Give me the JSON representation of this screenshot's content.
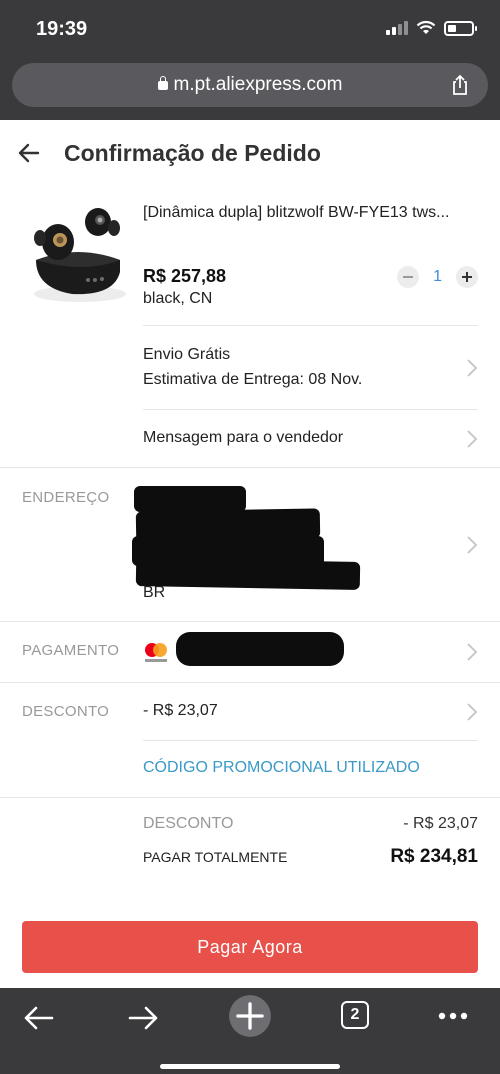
{
  "status_bar": {
    "time": "19:39"
  },
  "browser": {
    "url": "m.pt.aliexpress.com",
    "tab_count": "2"
  },
  "header": {
    "title": "Confirmação de Pedido"
  },
  "product": {
    "title": "[Dinâmica dupla] blitzwolf BW-FYE13 tws...",
    "price": "R$ 257,88",
    "variant": "black,  CN",
    "quantity": "1"
  },
  "shipping": {
    "line1": "Envio Grátis",
    "line2": "Estimativa de Entrega: 08 Nov."
  },
  "message_seller": "Mensagem para o vendedor",
  "address": {
    "label": "ENDEREÇO",
    "country": "BR"
  },
  "payment": {
    "label": "PAGAMENTO"
  },
  "discount": {
    "label": "DESCONTO",
    "value": "- R$ 23,07"
  },
  "promo": "CÓDIGO PROMOCIONAL UTILIZADO",
  "summary": {
    "discount_label": "DESCONTO",
    "discount_value": "- R$ 23,07",
    "total_label": "PAGAR TOTALMENTE",
    "total_value": "R$ 234,81"
  },
  "pay_button": "Pagar Agora",
  "colors": {
    "accent": "#e8504a",
    "link": "#3a99c8",
    "qty": "#3a8fd9"
  }
}
